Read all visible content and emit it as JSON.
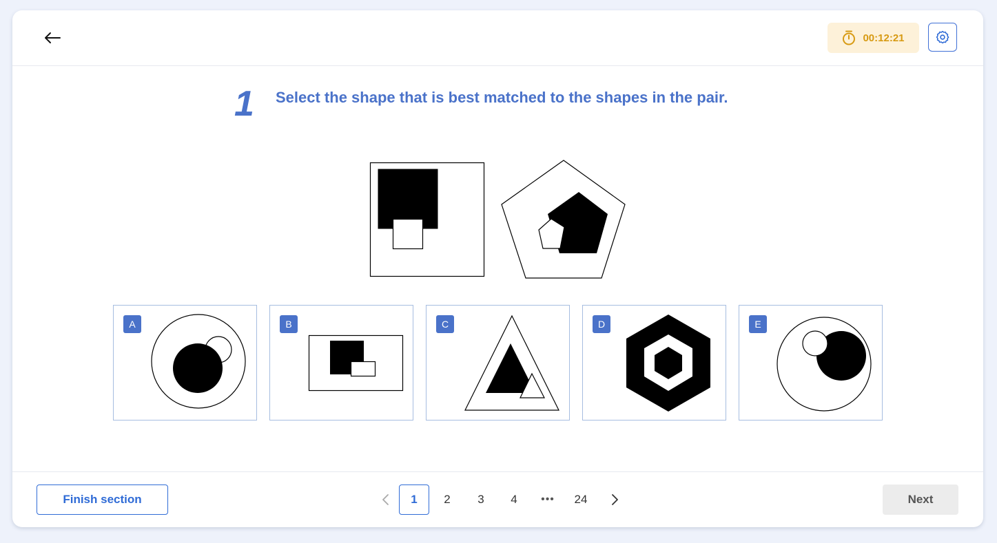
{
  "header": {
    "back_icon": "arrow-left-icon",
    "timer": {
      "icon": "stopwatch-icon",
      "value": "00:12:21",
      "color": "#d79a12",
      "bg": "#fdf1d9"
    },
    "settings_icon": "gear-icon"
  },
  "question": {
    "number": "1",
    "text": "Select the shape that is best matched to the shapes in the pair."
  },
  "options": [
    {
      "label": "A"
    },
    {
      "label": "B"
    },
    {
      "label": "C"
    },
    {
      "label": "D"
    },
    {
      "label": "E"
    }
  ],
  "footer": {
    "finish_label": "Finish section",
    "pages": [
      "1",
      "2",
      "3",
      "4",
      "•••",
      "24"
    ],
    "current_page": "1",
    "next_label": "Next",
    "prev_icon": "chevron-left-icon",
    "next_icon": "chevron-right-icon"
  },
  "colors": {
    "accent": "#4a72c9",
    "primary": "#2f6bd6"
  }
}
